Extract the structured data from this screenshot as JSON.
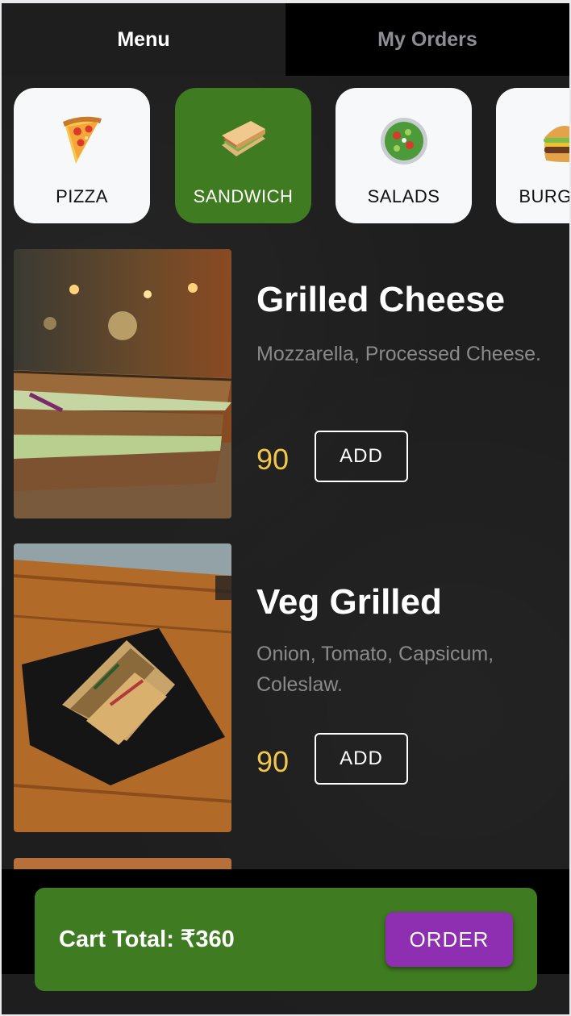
{
  "tabs": [
    {
      "label": "Menu",
      "active": true
    },
    {
      "label": "My Orders",
      "active": false
    }
  ],
  "categories": [
    {
      "label": "PIZZA",
      "icon": "pizza-icon",
      "selected": false
    },
    {
      "label": "SANDWICH",
      "icon": "sandwich-icon",
      "selected": true
    },
    {
      "label": "SALADS",
      "icon": "salad-icon",
      "selected": false
    },
    {
      "label": "BURGERS",
      "icon": "burger-icon",
      "selected": false
    }
  ],
  "items": [
    {
      "name": "Grilled Cheese",
      "description": "Mozzarella, Processed Cheese.",
      "price": "90",
      "add_label": "ADD"
    },
    {
      "name": "Veg Grilled",
      "description": "Onion, Tomato, Capsicum, Coleslaw.",
      "price": "90",
      "add_label": "ADD"
    }
  ],
  "cart": {
    "total_text": "Cart Total: ₹360",
    "order_label": "ORDER"
  },
  "colors": {
    "accent_green": "#3f7b20",
    "order_purple": "#8e2eb0",
    "price_yellow": "#f2c84b"
  }
}
